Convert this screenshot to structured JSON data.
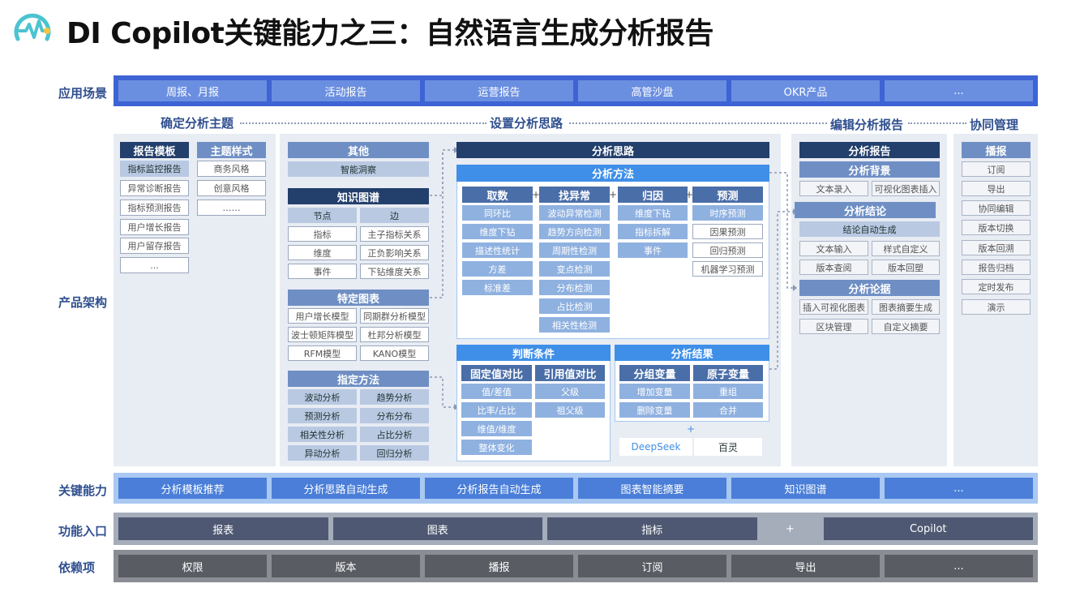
{
  "title": "DI Copilot关键能力之三：自然语言生成分析报告",
  "logo_icon": "pulse-chart-logo-icon",
  "rows": {
    "scenes": {
      "label": "应用场景",
      "items": [
        "周报、月报",
        "活动报告",
        "运营报告",
        "高管沙盘",
        "OKR产品",
        "..."
      ]
    },
    "arch": {
      "label": "产品架构"
    },
    "key": {
      "label": "关键能力",
      "items": [
        "分析模板推荐",
        "分析思路自动生成",
        "分析报告自动生成",
        "图表智能摘要",
        "知识图谱",
        "..."
      ]
    },
    "entry": {
      "label": "功能入口",
      "items": [
        "报表",
        "图表",
        "指标",
        "+",
        "Copilot"
      ]
    },
    "deps": {
      "label": "依赖项",
      "items": [
        "权限",
        "版本",
        "播报",
        "订阅",
        "导出",
        "..."
      ]
    }
  },
  "flow": [
    "确定分析主题",
    "设置分析思路",
    "编辑分析报告",
    "协同管理"
  ],
  "col1": {
    "template_title": "报告模板",
    "templates": [
      "指标监控报告",
      "异常诊断报告",
      "指标预测报告",
      "用户增长报告",
      "用户留存报告",
      "..."
    ],
    "theme_title": "主题样式",
    "themes": [
      "商务风格",
      "创意风格",
      "……"
    ]
  },
  "col2": {
    "other_title": "其他",
    "other_items": [
      "智能洞察"
    ],
    "kg_title": "知识图谱",
    "kg_items": [
      "节点",
      "边",
      "指标",
      "主子指标关系",
      "维度",
      "正负影响关系",
      "事件",
      "下钻维度关系"
    ],
    "chart_title": "特定图表",
    "chart_items": [
      "用户增长模型",
      "同期群分析模型",
      "波士顿矩阵模型",
      "杜邦分析模型",
      "RFM模型",
      "KANO模型"
    ],
    "method_title": "指定方法",
    "method_items": [
      "波动分析",
      "趋势分析",
      "预测分析",
      "分布分布",
      "相关性分析",
      "占比分析",
      "异动分析",
      "回归分析"
    ]
  },
  "col3": {
    "idea_title": "分析思路",
    "method_title": "分析方法",
    "groups": [
      {
        "title": "取数",
        "items": [
          "同环比",
          "维度下钻",
          "描述性统计",
          "方差",
          "标准差"
        ]
      },
      {
        "title": "找异常",
        "items": [
          "波动异常检测",
          "趋势方向检测",
          "周期性检测",
          "变点检测",
          "分布检测",
          "占比检测",
          "相关性检测"
        ]
      },
      {
        "title": "归因",
        "items": [
          "维度下钻",
          "指标拆解",
          "事件"
        ]
      },
      {
        "title": "预测",
        "items": [
          "时序预测",
          "因果预测",
          "回归预测",
          "机器学习预测"
        ]
      }
    ],
    "plus": "+",
    "cond_title": "判断条件",
    "cond_fixed": "固定值对比",
    "cond_fixed_items": [
      "值/差值",
      "比率/占比",
      "维值/维度",
      "整体变化"
    ],
    "cond_ref": "引用值对比",
    "cond_ref_items": [
      "父级",
      "祖父级"
    ],
    "result_title": "分析结果",
    "res_group": "分组变量",
    "res_group_items": [
      "增加变量",
      "删除变量"
    ],
    "res_atom": "原子变量",
    "res_atom_items": [
      "重组",
      "合并"
    ],
    "models": [
      "DeepSeek",
      "百灵"
    ]
  },
  "col4": {
    "report_title": "分析报告",
    "bg_title": "分析背景",
    "bg_items": [
      "文本录入",
      "可视化图表插入"
    ],
    "concl_title": "分析结论",
    "concl_auto": "结论自动生成",
    "concl_items": [
      "文本输入",
      "样式自定义",
      "版本查阅",
      "版本回塑"
    ],
    "evid_title": "分析论据",
    "evid_items": [
      "插入可视化图表",
      "图表摘要生成",
      "区块管理",
      "自定义摘要"
    ]
  },
  "col5": {
    "title": "播报",
    "items": [
      "订阅",
      "导出",
      "协同编辑",
      "版本切换",
      "版本回溯",
      "报告归档",
      "定时发布",
      "演示"
    ]
  }
}
